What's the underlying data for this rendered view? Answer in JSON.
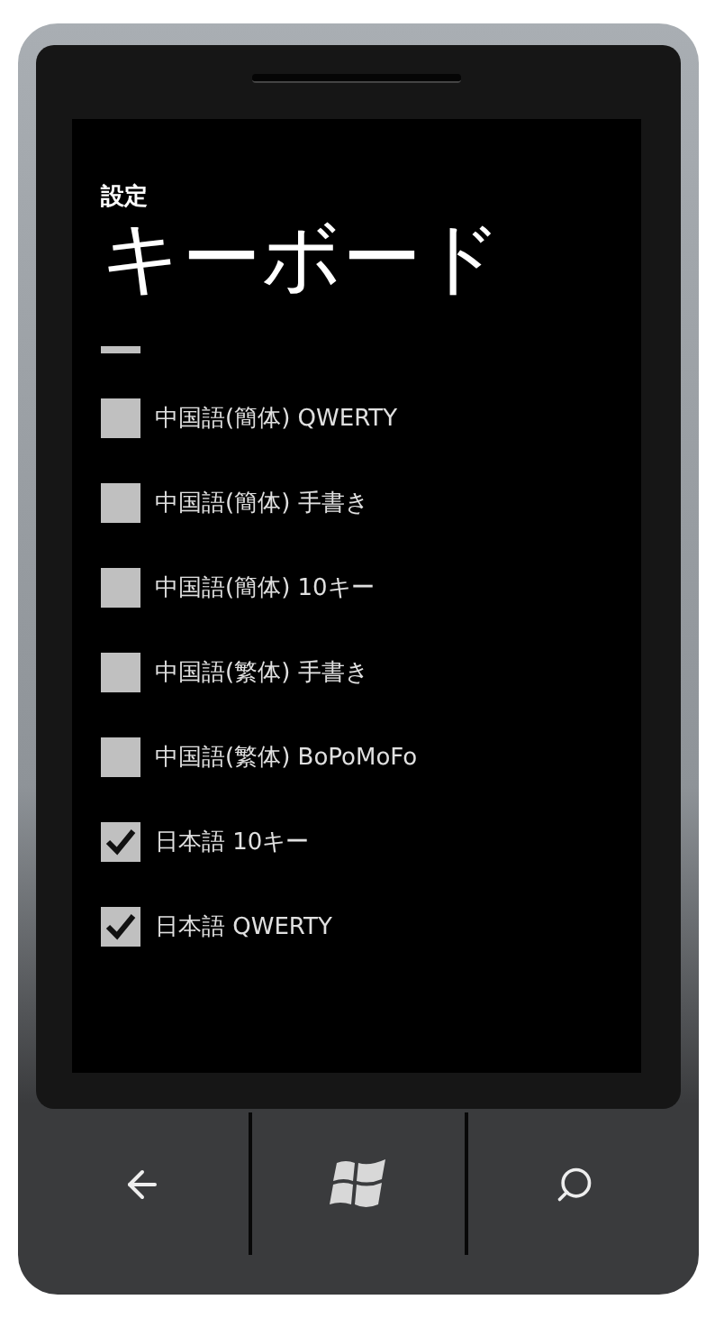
{
  "header": {
    "subtitle": "設定",
    "title": "キーボード"
  },
  "keyboards": [
    {
      "kind": "clipped",
      "checked": false
    },
    {
      "kind": "option",
      "label": "中国語(簡体) QWERTY",
      "checked": false
    },
    {
      "kind": "option",
      "label": "中国語(簡体) 手書き",
      "checked": false
    },
    {
      "kind": "option",
      "label": "中国語(簡体) 10キー",
      "checked": false
    },
    {
      "kind": "option",
      "label": "中国語(繁体) 手書き",
      "checked": false
    },
    {
      "kind": "option",
      "label": "中国語(繁体) BoPoMoFo",
      "checked": false
    },
    {
      "kind": "option",
      "label": "日本語 10キー",
      "checked": true
    },
    {
      "kind": "option",
      "label": "日本語 QWERTY",
      "checked": true
    }
  ],
  "hardware_buttons": [
    {
      "kind": "back"
    },
    {
      "kind": "start"
    },
    {
      "kind": "search"
    }
  ]
}
